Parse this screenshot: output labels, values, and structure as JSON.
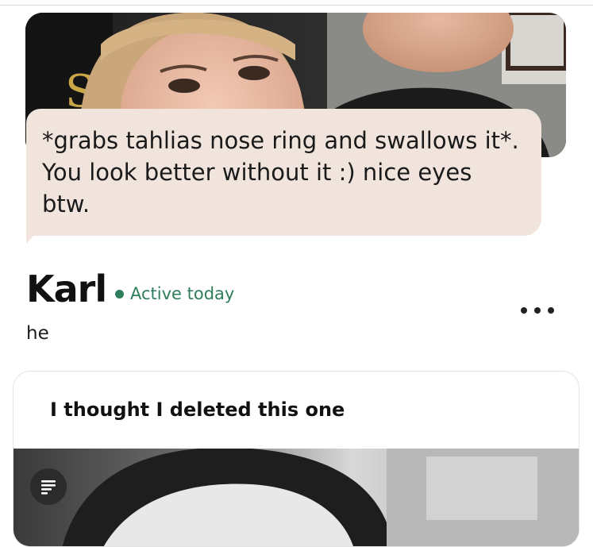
{
  "message": {
    "text": "*grabs tahlias nose ring and swallows it*. You look better without it :) nice eyes btw."
  },
  "profile": {
    "name": "Karl",
    "status": "Active today",
    "pronouns": "he"
  },
  "prompt": {
    "text": "I thought I deleted this one"
  },
  "icons": {
    "more": "more-options-icon",
    "notes": "notes-icon"
  },
  "colors": {
    "bubble": "#f0e4dd",
    "status": "#2e7d5b"
  }
}
